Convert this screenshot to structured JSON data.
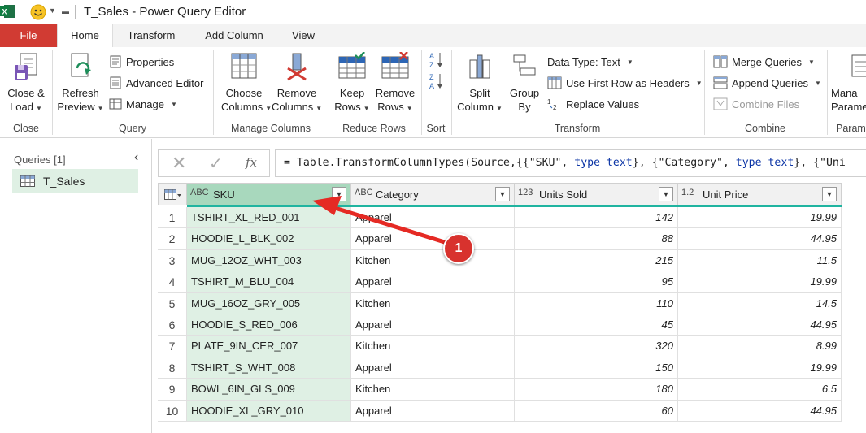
{
  "window": {
    "title": "T_Sales - Power Query Editor"
  },
  "tabs": {
    "file": "File",
    "home": "Home",
    "transform": "Transform",
    "add_column": "Add Column",
    "view": "View"
  },
  "ribbon": {
    "close": {
      "label1": "Close &",
      "label2": "Load",
      "group": "Close"
    },
    "query": {
      "refresh1": "Refresh",
      "refresh2": "Preview",
      "properties": "Properties",
      "advanced_editor": "Advanced Editor",
      "manage": "Manage",
      "group": "Query"
    },
    "manage_columns": {
      "choose1": "Choose",
      "choose2": "Columns",
      "remove1": "Remove",
      "remove2": "Columns",
      "group": "Manage Columns"
    },
    "reduce_rows": {
      "keep1": "Keep",
      "keep2": "Rows",
      "remove1": "Remove",
      "remove2": "Rows",
      "group": "Reduce Rows"
    },
    "sort": {
      "group": "Sort"
    },
    "transform": {
      "split1": "Split",
      "split2": "Column",
      "group1": "Group",
      "group2": "By",
      "data_type": "Data Type: Text",
      "first_row": "Use First Row as Headers",
      "replace": "Replace Values",
      "group": "Transform"
    },
    "combine": {
      "merge": "Merge Queries",
      "append": "Append Queries",
      "combine_files": "Combine Files",
      "group": "Combine"
    },
    "params": {
      "label1": "Mana",
      "label2": "Parame",
      "group": "Param"
    }
  },
  "queries_pane": {
    "header": "Queries [1]",
    "items": [
      "T_Sales"
    ]
  },
  "formula": {
    "p1": "= Table.TransformColumnTypes(Source,{{\"SKU\", ",
    "k1": "type text",
    "p2": "}, {\"Category\", ",
    "k2": "type text",
    "p3": "}, {\"Uni"
  },
  "table": {
    "columns": [
      {
        "type": "ABC",
        "name": "SKU"
      },
      {
        "type": "ABC",
        "name": "Category"
      },
      {
        "type": "123",
        "name": "Units Sold"
      },
      {
        "type": "1.2",
        "name": "Unit Price"
      }
    ],
    "rows": [
      {
        "idx": "1",
        "sku": "TSHIRT_XL_RED_001",
        "category": "Apparel",
        "units": "142",
        "price": "19.99"
      },
      {
        "idx": "2",
        "sku": "HOODIE_L_BLK_002",
        "category": "Apparel",
        "units": "88",
        "price": "44.95"
      },
      {
        "idx": "3",
        "sku": "MUG_12OZ_WHT_003",
        "category": "Kitchen",
        "units": "215",
        "price": "11.5"
      },
      {
        "idx": "4",
        "sku": "TSHIRT_M_BLU_004",
        "category": "Apparel",
        "units": "95",
        "price": "19.99"
      },
      {
        "idx": "5",
        "sku": "MUG_16OZ_GRY_005",
        "category": "Kitchen",
        "units": "110",
        "price": "14.5"
      },
      {
        "idx": "6",
        "sku": "HOODIE_S_RED_006",
        "category": "Apparel",
        "units": "45",
        "price": "44.95"
      },
      {
        "idx": "7",
        "sku": "PLATE_9IN_CER_007",
        "category": "Kitchen",
        "units": "320",
        "price": "8.99"
      },
      {
        "idx": "8",
        "sku": "TSHIRT_S_WHT_008",
        "category": "Apparel",
        "units": "150",
        "price": "19.99"
      },
      {
        "idx": "9",
        "sku": "BOWL_6IN_GLS_009",
        "category": "Kitchen",
        "units": "180",
        "price": "6.5"
      },
      {
        "idx": "10",
        "sku": "HOODIE_XL_GRY_010",
        "category": "Apparel",
        "units": "60",
        "price": "44.95"
      }
    ]
  },
  "callout": {
    "number": "1"
  },
  "colors": {
    "file_tab": "#d13b33",
    "selected_column": "#a8d8bd",
    "selected_cells": "#dff0e4",
    "accent_bar": "#20b4a0",
    "callout": "#d8322e"
  }
}
